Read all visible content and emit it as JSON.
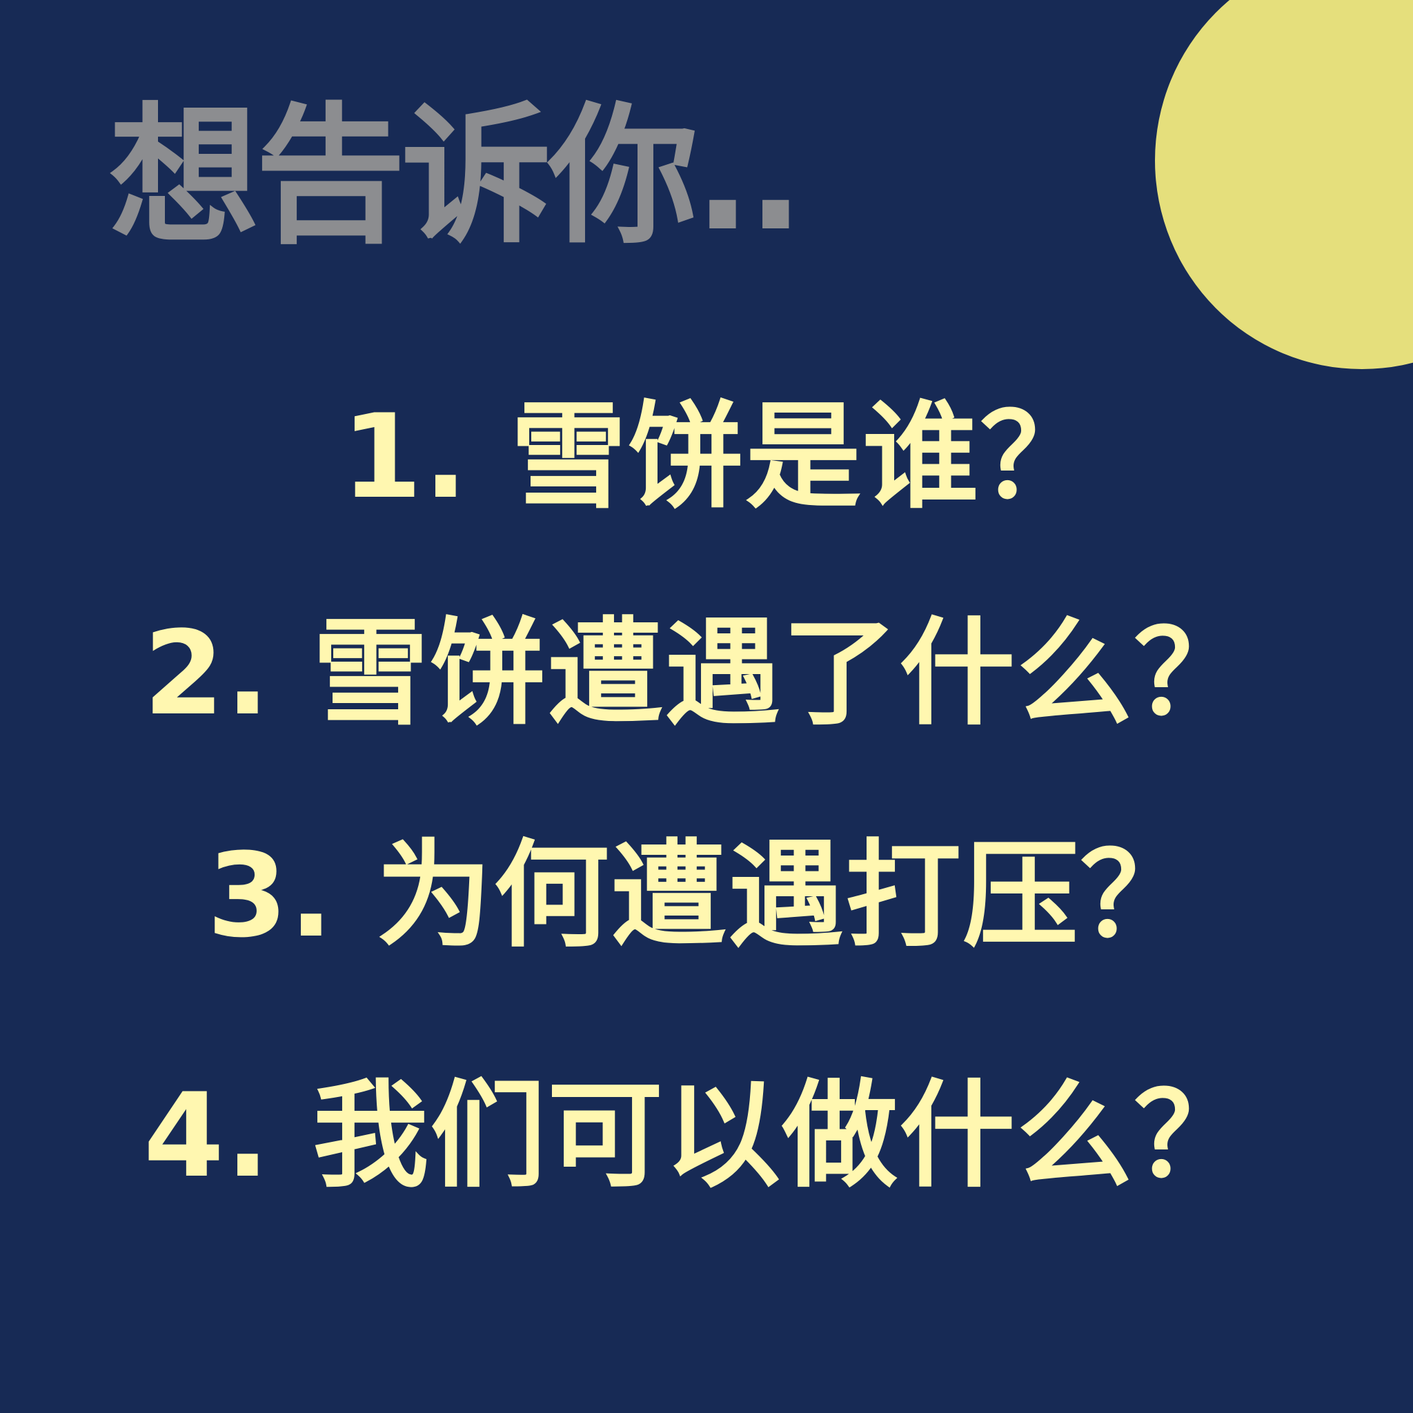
{
  "colors": {
    "background": "#172a55",
    "moon": "#e5df7c",
    "title": "#8c8d90",
    "questions": "#fff7b0"
  },
  "title": "想告诉你..",
  "questions": [
    "1. 雪饼是谁？",
    "2. 雪饼遭遇了什么？",
    "3. 为何遭遇打压？",
    "4. 我们可以做什么？"
  ]
}
